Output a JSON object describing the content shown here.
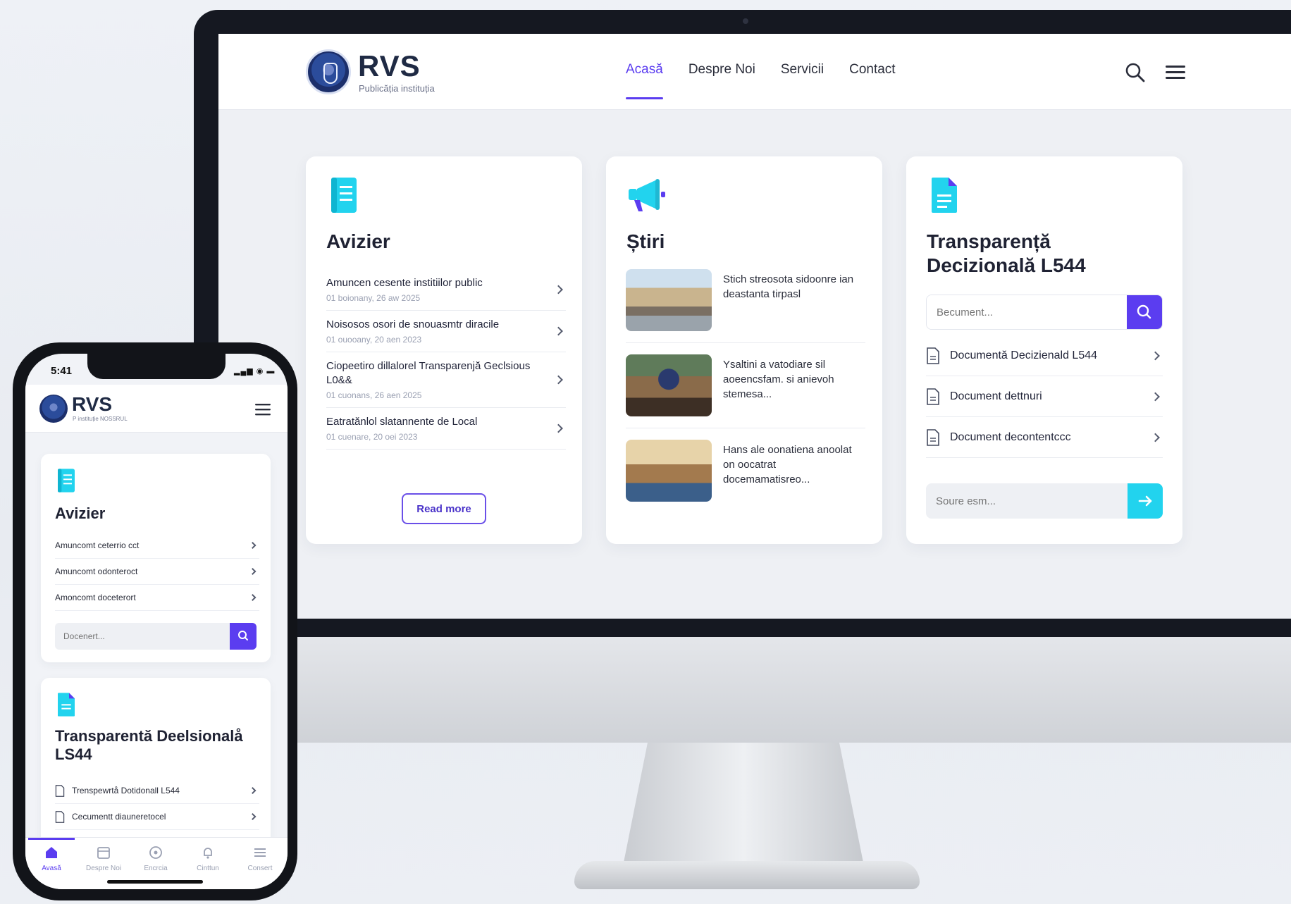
{
  "colors": {
    "accent": "#5b3df0",
    "cyan": "#22d3ee",
    "dark": "#1f2233"
  },
  "desktop": {
    "logo": {
      "title": "RVS",
      "subtitle": "Publicăția instituția"
    },
    "nav": [
      "Acasă",
      "Despre Noi",
      "Servicii",
      "Contact"
    ],
    "avizier": {
      "title": "Avizier",
      "items": [
        {
          "title": "Amuncen cesente institiilor public",
          "date": "01 boionany, 26 aw 2025"
        },
        {
          "title": "Noisosos osori de snouasmtr diracile",
          "date": "01 ouooany, 20 aen 2023"
        },
        {
          "title": "Ciopeetiro dillalorel Transparenjă Geclsious L0&&",
          "date": "01 cuonans, 26 aen 2025"
        },
        {
          "title": "Eatratănlol slatannente de Local",
          "date": "01 cuenare, 20 oei 2023"
        }
      ],
      "button": "Read more"
    },
    "stiri": {
      "title": "Știri",
      "items": [
        "Stich streosota sidoonre ian deastanta tirpasl",
        "Ysaltini a vatodiare sil aoeencsfam. si anievoh stemesa...",
        "Hans ale oonatiena anoolat on oocatrat docemamatisreo..."
      ]
    },
    "transparenta": {
      "title": "Transparență Decizională L544",
      "search_placeholder": "Becument...",
      "docs": [
        "Documentă Decizienald L544",
        "Document dettnuri",
        "Document decontentccc"
      ],
      "subscribe_placeholder": "Soure esm..."
    }
  },
  "mobile": {
    "time": "5:41",
    "logo": {
      "title": "RVS",
      "subtitle": "P instituție NOSSRUL"
    },
    "avizier": {
      "title": "Avizier",
      "items": [
        "Amuncomt ceterrio cct",
        "Amuncomt odonteroct",
        "Amoncomt doceterort"
      ],
      "search_placeholder": "Docenert..."
    },
    "transparenta": {
      "title": "Transparentă Deelsionalå LS44",
      "docs": [
        "Trenspewrtå Dotidonall L544",
        "Cecumentt diauneretocel"
      ]
    },
    "tabs": [
      "Avasă",
      "Despre Noi",
      "Encrcia",
      "Cinttun",
      "Consert"
    ]
  }
}
